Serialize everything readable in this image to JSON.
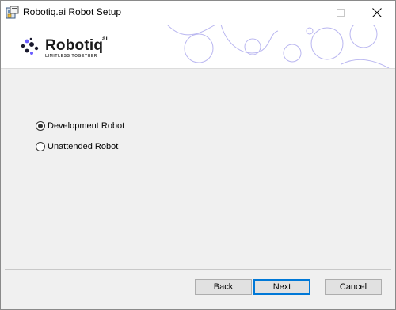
{
  "window": {
    "title": "Robotiq.ai Robot Setup",
    "icons": {
      "app": "installer-icon",
      "minimize": "minimize-icon",
      "maximize": "maximize-icon",
      "close": "close-icon"
    }
  },
  "brand": {
    "name": "Robotiq",
    "superscript": "ai",
    "tagline": "LIMITLESS TOGETHER",
    "logo_icon": "robotiq-dots-logo"
  },
  "options": [
    {
      "label": "Development Robot",
      "selected": true
    },
    {
      "label": "Unattended Robot",
      "selected": false
    }
  ],
  "buttons": {
    "back": "Back",
    "next": "Next",
    "cancel": "Cancel"
  },
  "colors": {
    "accent": "#0078d7",
    "decor_circles": "#b9b6f0",
    "window_bg": "#f0f0f0"
  }
}
